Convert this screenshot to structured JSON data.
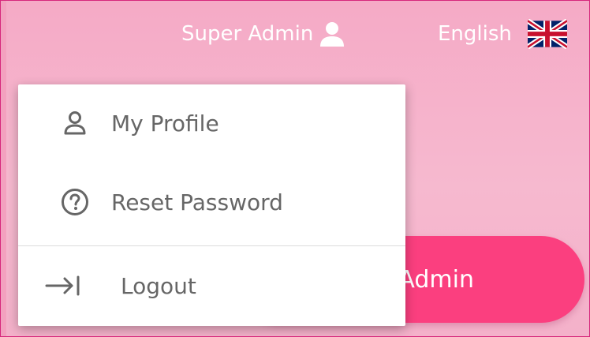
{
  "header": {
    "user_name": "Super Admin",
    "language": "English",
    "user_icon": "user-icon",
    "flag_icon": "uk-flag-icon"
  },
  "background": {
    "admin_button_label": "Admin",
    "accent_color": "#fb3f7f",
    "page_background": "#f6b9cf"
  },
  "dropdown": {
    "items": [
      {
        "label": "My Profile",
        "icon": "user-icon"
      },
      {
        "label": "Reset Password",
        "icon": "question-circle-icon"
      },
      {
        "label": "Logout",
        "icon": "logout-arrow-icon"
      }
    ]
  }
}
